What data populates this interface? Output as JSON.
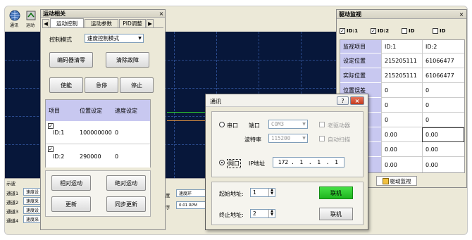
{
  "toolbar": {
    "item1_label": "通讯",
    "item2_label": "运动"
  },
  "motion_panel": {
    "title": "运动相关",
    "tabs": [
      "运动控制",
      "运动参数",
      "PID调整"
    ],
    "control_mode_label": "控制模式",
    "control_mode_value": "速度控制模式",
    "buttons": {
      "encoder_reset": "编码器清零",
      "clear_fault": "清除故障",
      "enable": "使能",
      "estop": "急停",
      "stop": "停止",
      "relative": "相对运动",
      "absolute": "绝对运动",
      "update": "更新",
      "sync_update": "同步更新"
    },
    "table": {
      "headers": [
        "项目",
        "位置设定",
        "速度设定"
      ],
      "rows": [
        {
          "id": "ID:1",
          "position": "100000000",
          "speed": "0",
          "checked": "✓"
        },
        {
          "id": "ID:2",
          "position": "290000",
          "speed": "0",
          "checked": "✓"
        }
      ]
    }
  },
  "channels": {
    "title": "示波",
    "rows": [
      {
        "label": "通道1",
        "value": "速度设"
      },
      {
        "label": "通道2",
        "value": "速度采"
      },
      {
        "label": "通道3",
        "value": "速度设"
      },
      {
        "label": "通道4",
        "value": "速度采"
      }
    ],
    "mid_labels": {
      "a": "度",
      "b": "字"
    },
    "mid_values": {
      "a": "速度环",
      "b": "0.01 RPM"
    }
  },
  "drive_monitor": {
    "title": "驱动监视",
    "checks": [
      {
        "label": "ID:1",
        "checked": "✓"
      },
      {
        "label": "ID:2",
        "checked": "✓"
      },
      {
        "label": "ID",
        "checked": ""
      },
      {
        "label": "ID",
        "checked": ""
      }
    ],
    "headers": [
      "监视项目",
      "ID:1",
      "ID:2"
    ],
    "rows": [
      {
        "item": "设定位置",
        "v1": "215205111",
        "v2": "61066477"
      },
      {
        "item": "实际位置",
        "v1": "215205111",
        "v2": "61066477"
      },
      {
        "item": "位置误差",
        "v1": "0",
        "v2": "0"
      },
      {
        "item": "",
        "v1": "0",
        "v2": "0"
      },
      {
        "item": "",
        "v1": "0",
        "v2": "0"
      },
      {
        "item": "",
        "v1": "0.00",
        "v2": "0.00"
      },
      {
        "item": "",
        "v1": "0.00",
        "v2": "0.00"
      },
      {
        "item": "",
        "v1": "0.00",
        "v2": "0.00"
      }
    ],
    "bottom_tab": "驱动监视"
  },
  "comm_dialog": {
    "title": "通讯",
    "serial_label": "串口",
    "port_label": "端口",
    "port_value": "COM3",
    "baud_label": "波特率",
    "baud_value": "115200",
    "old_driver_label": "老驱动器",
    "auto_scan_label": "自动扫描",
    "net_label": "网口",
    "ip_label": "IP地址",
    "ip": [
      "172",
      "1",
      "1",
      "1"
    ],
    "start_addr_label": "起始地址:",
    "start_addr_value": "1",
    "end_addr_label": "终止地址:",
    "end_addr_value": "2",
    "connect_green": "联机",
    "connect": "联机"
  },
  "colors": {
    "plot_bg": "#07173a",
    "accent_green": "#2ecc2e",
    "table_lavender": "#c8c8f0"
  }
}
